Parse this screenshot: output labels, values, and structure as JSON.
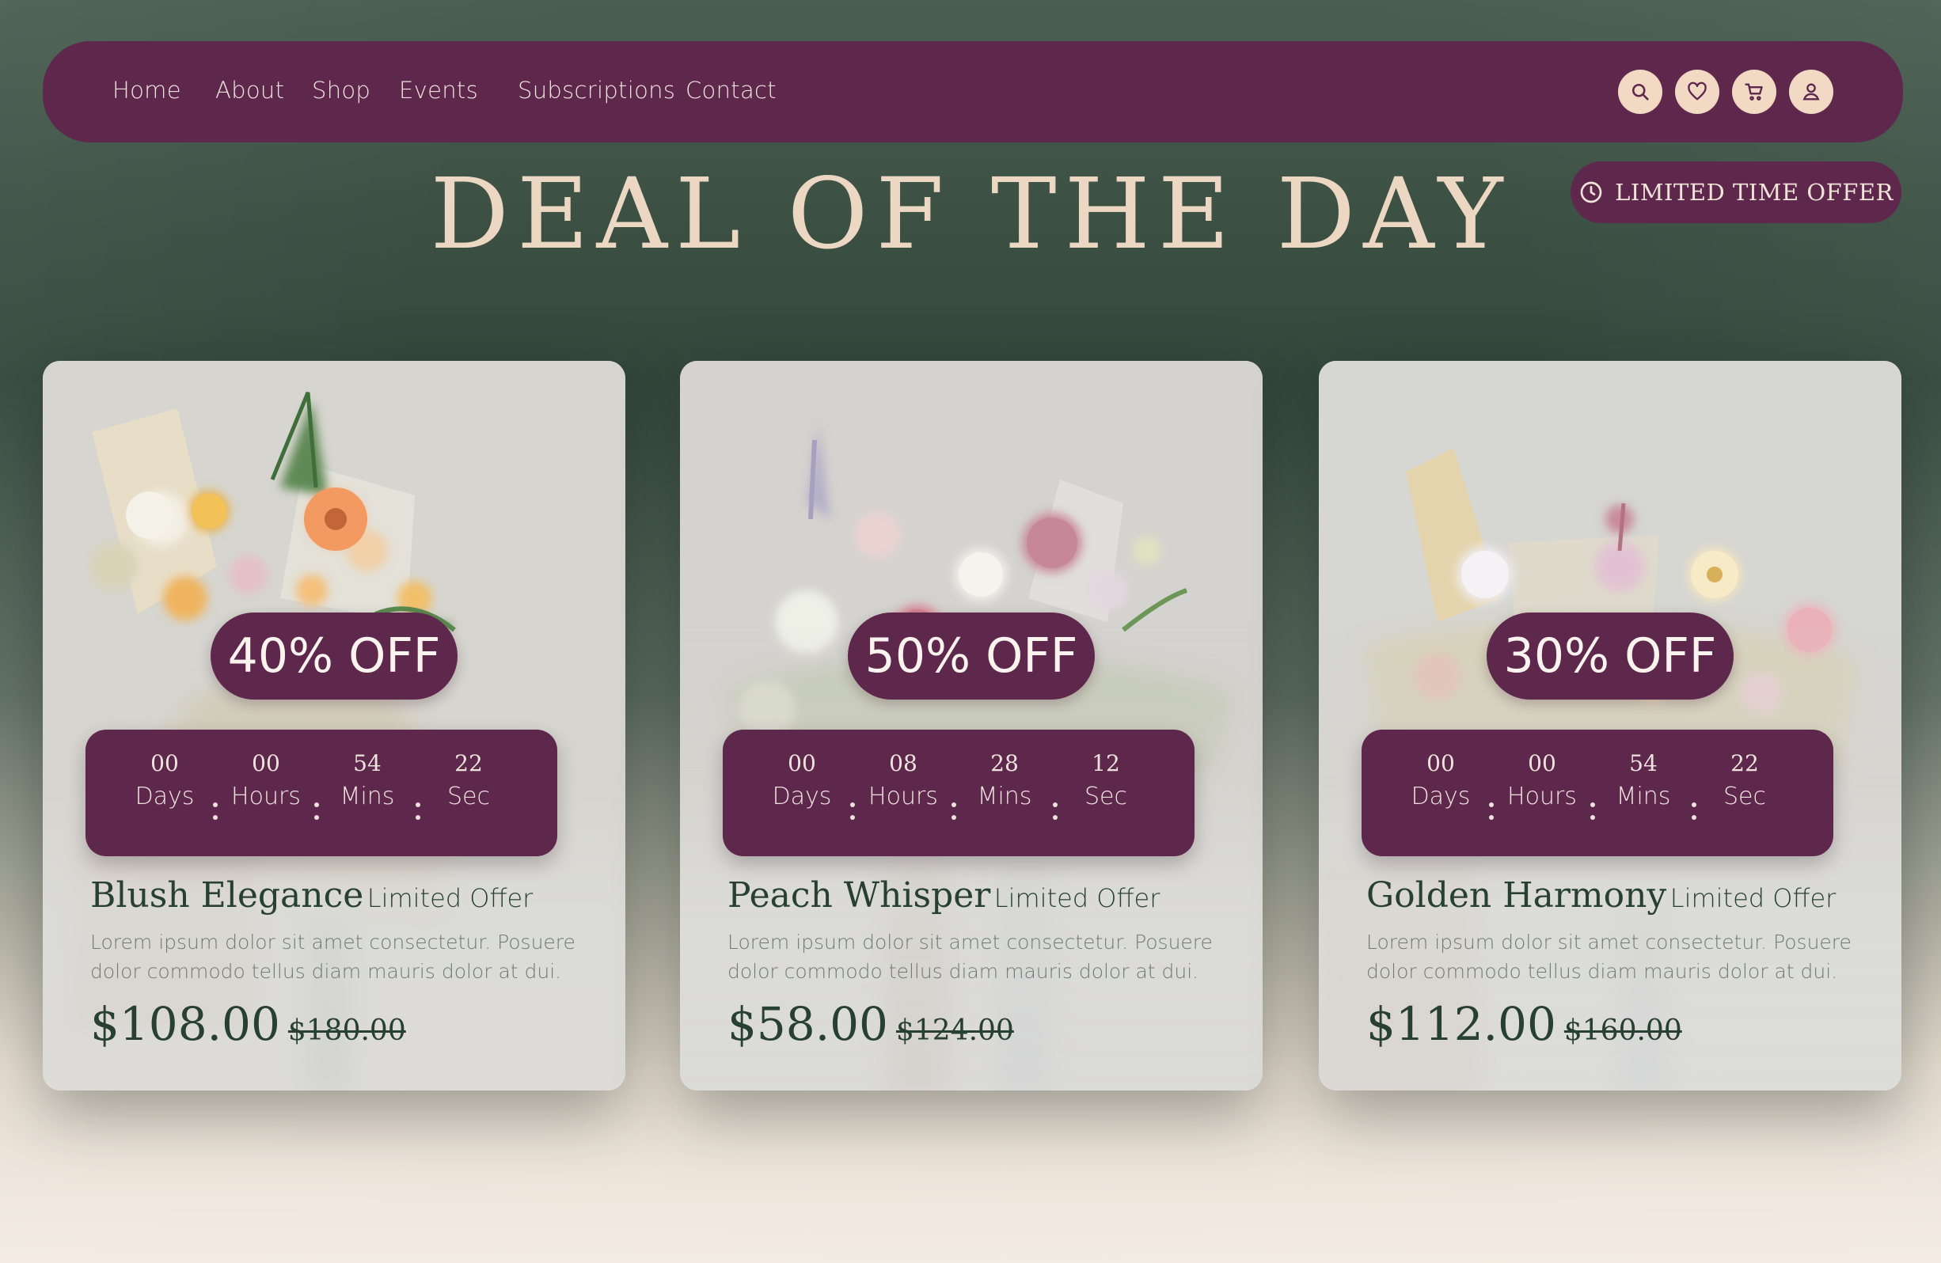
{
  "nav": {
    "links": [
      "Home",
      "About",
      "Shop",
      "Events",
      "Subscriptions",
      "Contact"
    ],
    "icons": [
      "search-icon",
      "heart-icon",
      "cart-icon",
      "user-icon"
    ]
  },
  "headline": "DEAL OF THE DAY",
  "limited_badge": {
    "label": "LIMITED TIME OFFER",
    "icon": "clock-icon"
  },
  "timer_labels": [
    "Days",
    "Hours",
    "Mins",
    "Sec"
  ],
  "cards": [
    {
      "discount": "40% OFF",
      "timer": [
        "00",
        "00",
        "54",
        "22"
      ],
      "name": "Blush Elegance",
      "tag": "Limited Offer",
      "description": "Lorem ipsum dolor sit amet consectetur. Posuere dolor commodo tellus diam mauris dolor at dui.",
      "price": "$108.00",
      "old_price": "$180.00"
    },
    {
      "discount": "50% OFF",
      "timer": [
        "00",
        "08",
        "28",
        "12"
      ],
      "name": "Peach Whisper",
      "tag": "Limited Offer",
      "description": "Lorem ipsum dolor sit amet consectetur. Posuere dolor commodo tellus diam mauris dolor at dui.",
      "price": "$58.00",
      "old_price": "$124.00"
    },
    {
      "discount": "30% OFF",
      "timer": [
        "00",
        "00",
        "54",
        "22"
      ],
      "name": "Golden Harmony",
      "tag": "Limited Offer",
      "description": "Lorem ipsum dolor sit amet consectetur. Posuere dolor commodo tellus diam mauris dolor at dui.",
      "price": "$112.00",
      "old_price": "$160.00"
    }
  ],
  "colors": {
    "plum": "#5e284d",
    "cream": "#ecd8c2",
    "forest": "#27402f",
    "icon_bg": "#f1d9c4"
  }
}
